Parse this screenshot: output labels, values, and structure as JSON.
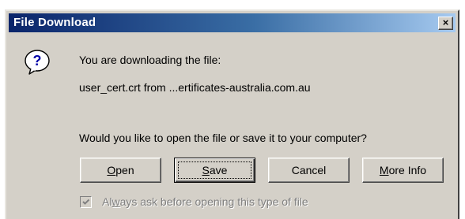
{
  "window": {
    "title": "File Download",
    "close_glyph": "×"
  },
  "icon": {
    "name": "question-icon",
    "glyph": "?"
  },
  "message": {
    "line1": "You are downloading the file:",
    "line2": "user_cert.crt from ...ertificates-australia.com.au",
    "line3": "Would you like to open the file or save it to your computer?"
  },
  "buttons": {
    "open": {
      "mnemonic": "O",
      "rest": "pen"
    },
    "save": {
      "mnemonic": "S",
      "rest": "ave"
    },
    "cancel": {
      "label": "Cancel"
    },
    "more_info": {
      "mnemonic": "M",
      "rest": "ore Info"
    }
  },
  "checkbox": {
    "checked": true,
    "enabled": false,
    "mnemonic": "w",
    "prefix": "Al",
    "rest": "ays ask before opening this type of file"
  },
  "colors": {
    "titlebar_start": "#0a246a",
    "titlebar_end": "#a6caf0",
    "face": "#d4d0c8",
    "disabled_text": "#808080"
  }
}
